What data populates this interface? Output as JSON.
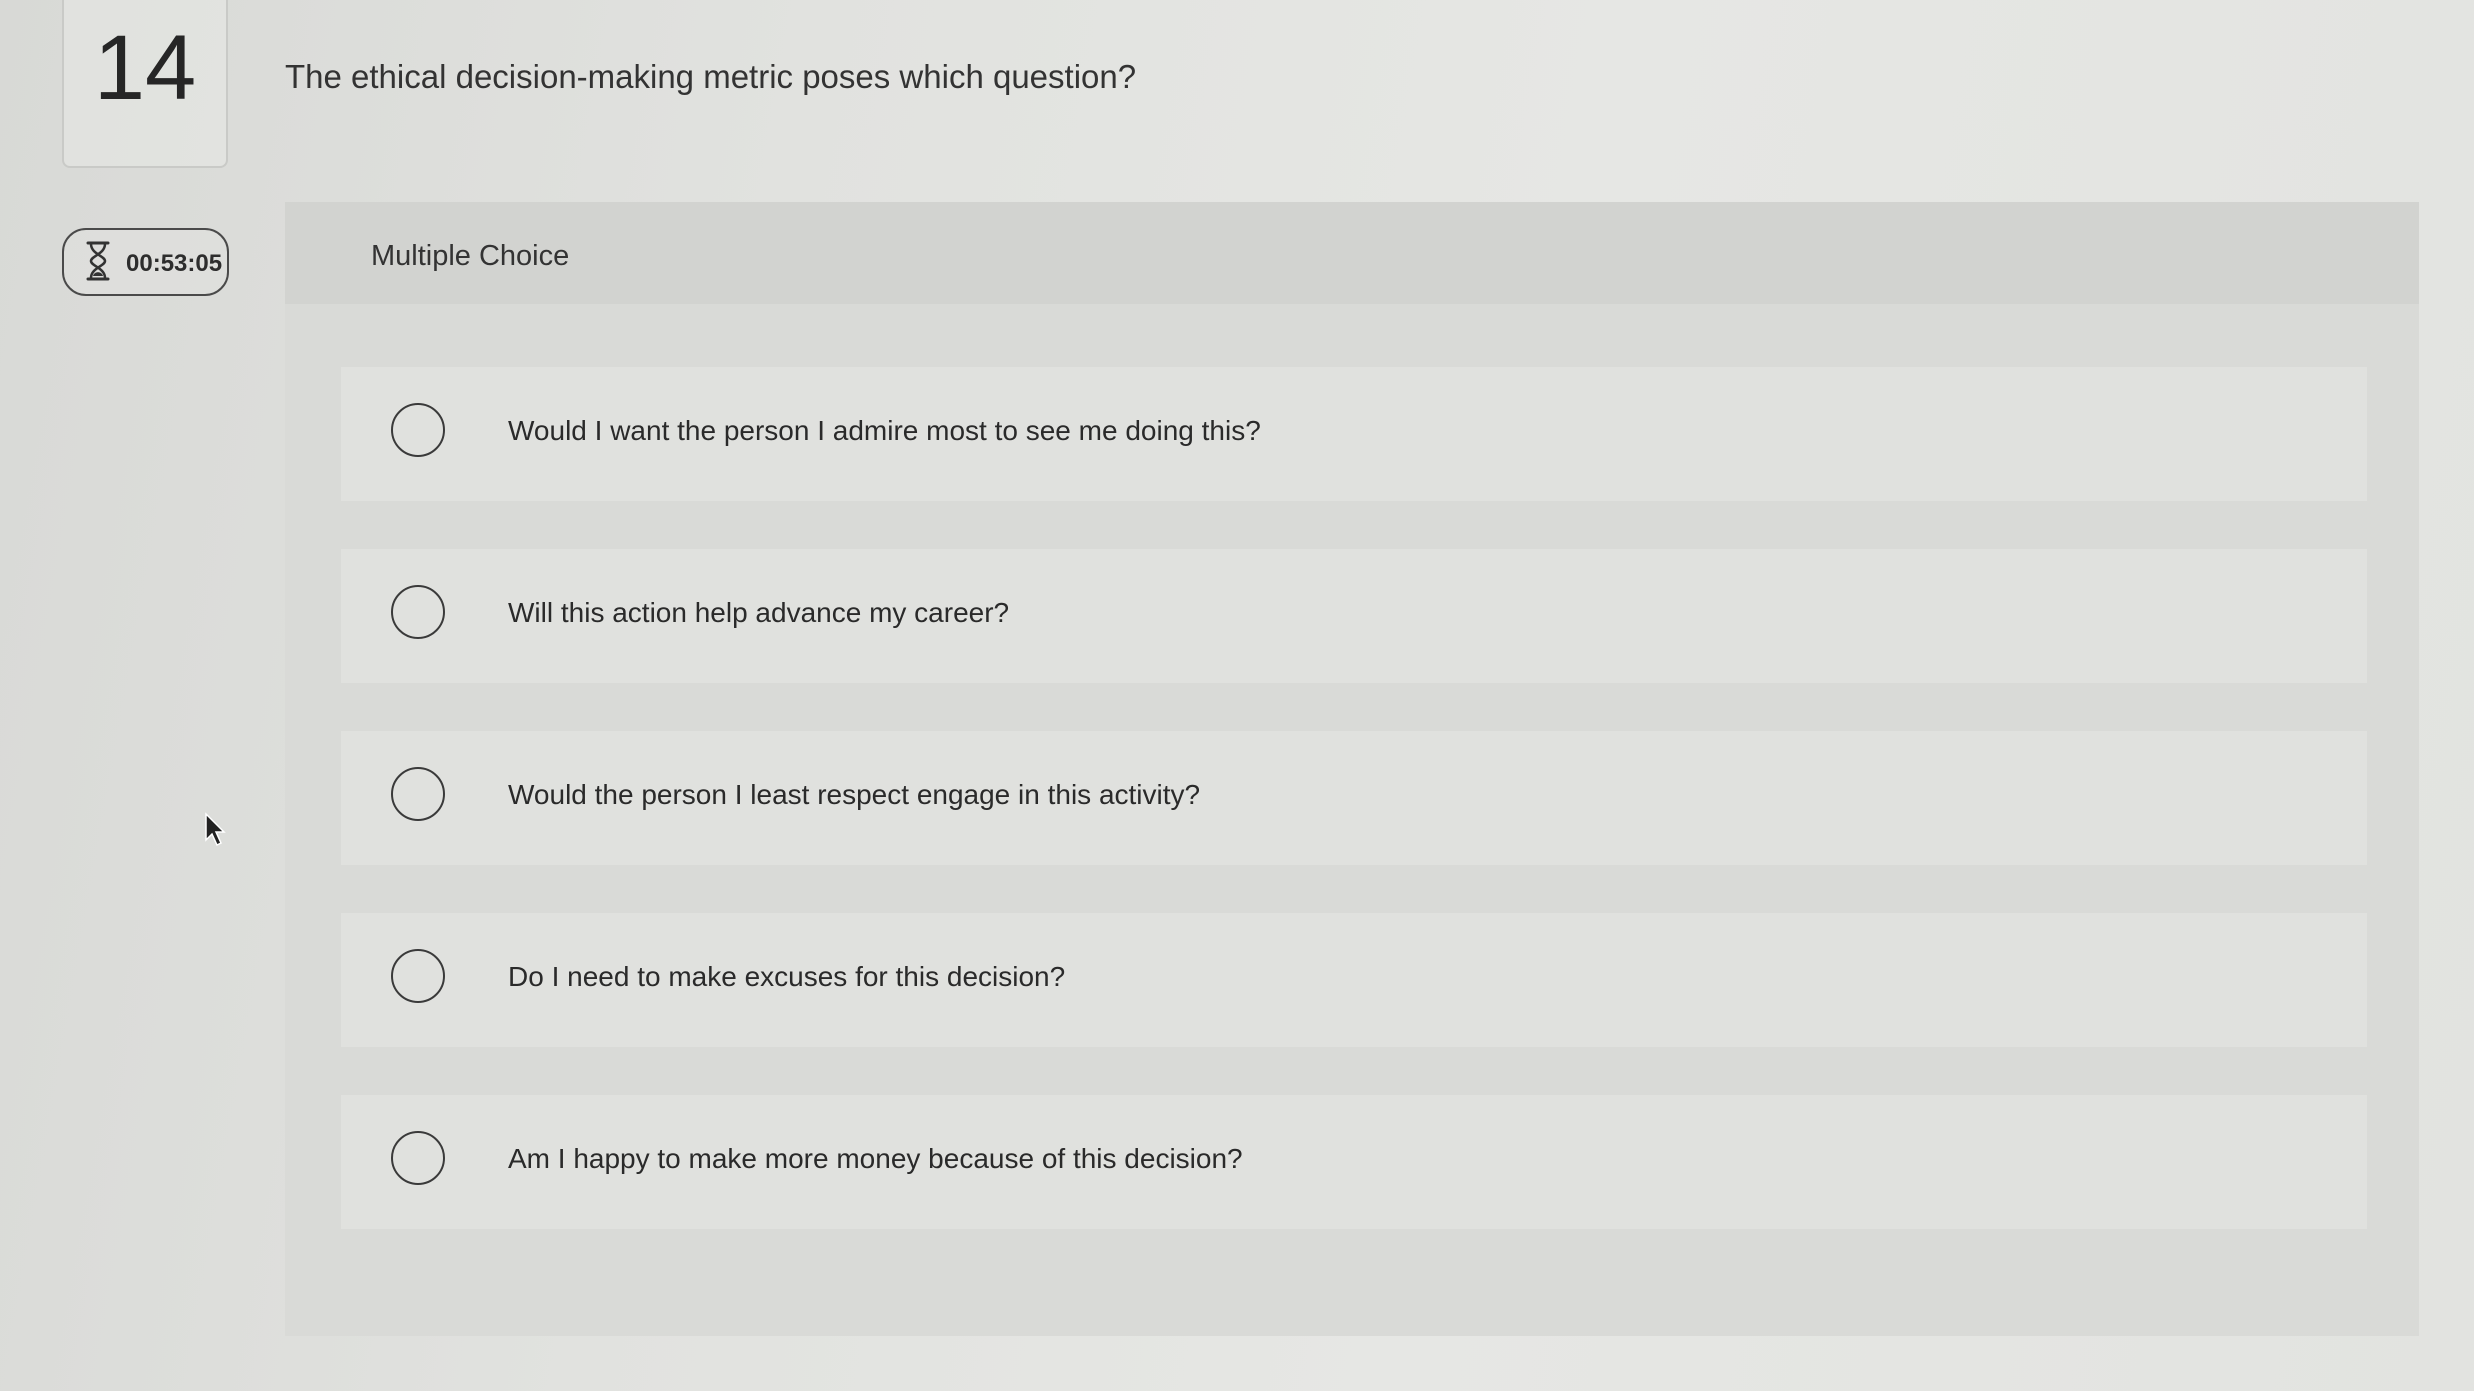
{
  "question": {
    "number": "14",
    "text": "The ethical decision-making metric poses which question?",
    "type_label": "Multiple Choice"
  },
  "timer": {
    "icon": "hourglass-icon",
    "value": "00:53:05"
  },
  "options": [
    {
      "label": "Would I want the person I admire most to see me doing this?",
      "selected": false
    },
    {
      "label": "Will this action help advance my career?",
      "selected": false
    },
    {
      "label": "Would the person I least respect engage in this activity?",
      "selected": false
    },
    {
      "label": "Do I need to make excuses for this decision?",
      "selected": false
    },
    {
      "label": "Am I happy to make more money because of this decision?",
      "selected": false
    }
  ]
}
